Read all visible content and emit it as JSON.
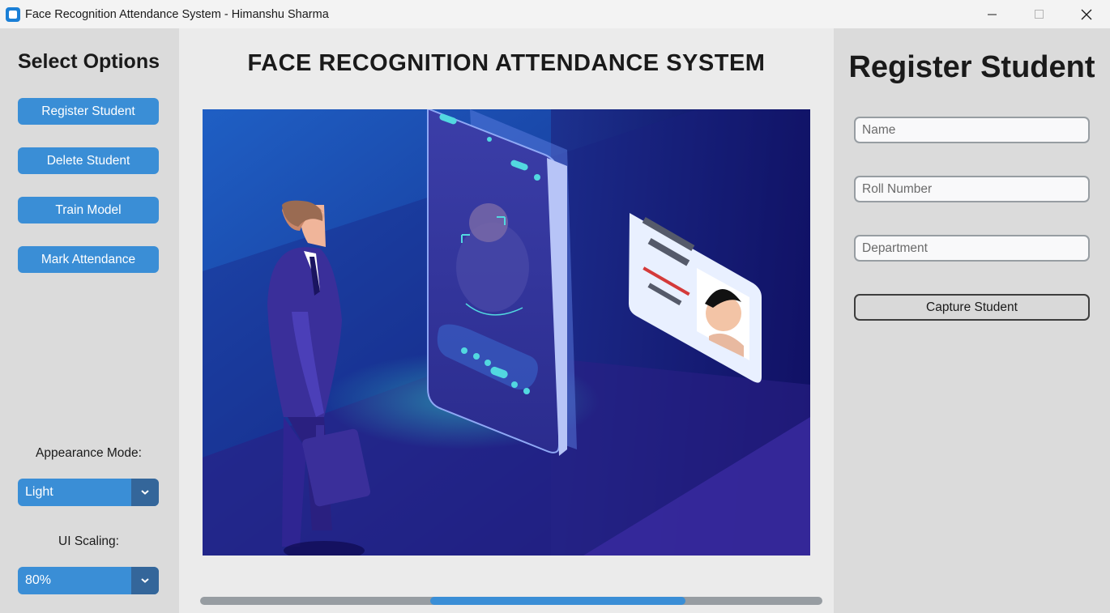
{
  "window": {
    "title": "Face Recognition Attendance System - Himanshu Sharma",
    "controls": [
      "minimize-icon",
      "maximize-icon",
      "close-icon"
    ]
  },
  "sidebar": {
    "title": "Select Options",
    "buttons": [
      {
        "label": "Register Student"
      },
      {
        "label": "Delete Student"
      },
      {
        "label": "Train Model"
      },
      {
        "label": "Mark Attendance"
      }
    ],
    "appearance_label": "Appearance Mode:",
    "appearance_value": "Light",
    "scaling_label": "UI Scaling:",
    "scaling_value": "80%"
  },
  "main": {
    "title": "FACE RECOGNITION ATTENDANCE SYSTEM",
    "illustration_icon": "face-scan-illustration",
    "scroll_thumb_start_fraction": 0.37,
    "scroll_thumb_size_fraction": 0.41
  },
  "register": {
    "title": "Register Student",
    "name_placeholder": "Name",
    "roll_placeholder": "Roll Number",
    "dept_placeholder": "Department",
    "capture_label": "Capture Student"
  },
  "colors": {
    "accent": "#3a8ed6",
    "accent_dark": "#34669a",
    "sidebar_bg": "#dbdbdb",
    "main_bg": "#ebebeb"
  }
}
